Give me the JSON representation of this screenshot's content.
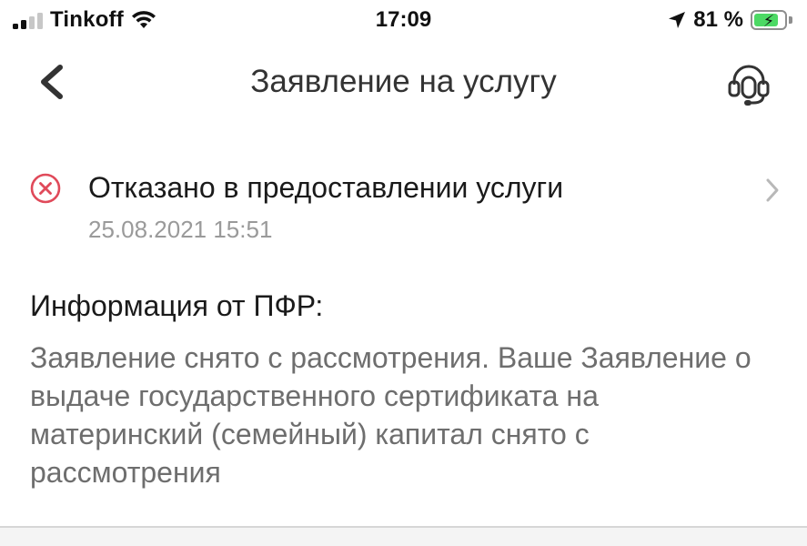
{
  "status_bar": {
    "carrier": "Tinkoff",
    "time": "17:09",
    "battery_percent": "81 %",
    "battery_level": 0.81,
    "signal_bars_filled": 2,
    "signal_bars_total": 4
  },
  "nav": {
    "title": "Заявление на услугу",
    "back_icon": "chevron-left-icon",
    "support_icon": "headset-icon"
  },
  "application_status": {
    "title": "Отказано в предоставлении услуги",
    "date": "25.08.2021 15:51",
    "status_color": "#e04a5a"
  },
  "info": {
    "heading": "Информация от ПФР:",
    "body": "Заявление снято с рассмотрения. Ваше Заявление о выдаче государственного сертификата на материнский (семейный) капитал снято с рассмотрения"
  }
}
